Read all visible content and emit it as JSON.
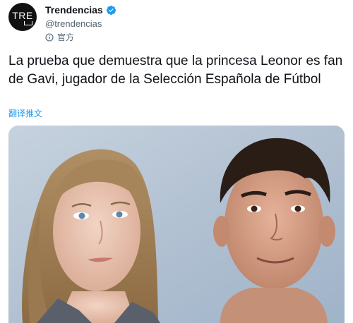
{
  "account": {
    "display_name": "Trendencias",
    "handle": "@trendencias",
    "official_label": "官方",
    "avatar_text": "TRE"
  },
  "tweet": {
    "text": "La prueba que demuestra que la princesa Leonor es fan de Gavi, jugador de la Selección Española de Fútbol",
    "translate_label": "翻译推文"
  },
  "media": {
    "icon": "photo"
  },
  "colors": {
    "accent": "#1d9bf0",
    "secondary_text": "#536471"
  }
}
